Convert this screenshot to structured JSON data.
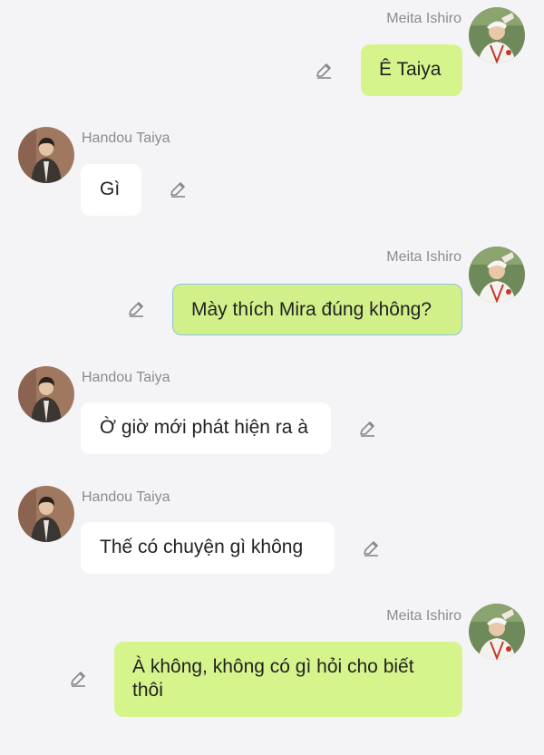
{
  "chat": {
    "messages": [
      {
        "sender": "Meita Ishiro",
        "side": "me",
        "text": "Ê Taiya",
        "avatar_icon": "boy-cap-avatar"
      },
      {
        "sender": "Handou Taiya",
        "side": "them",
        "text": "Gì",
        "avatar_icon": "boy-coat-avatar"
      },
      {
        "sender": "Meita Ishiro",
        "side": "me",
        "text": "Mày thích Mira đúng không?",
        "avatar_icon": "boy-cap-avatar"
      },
      {
        "sender": "Handou Taiya",
        "side": "them",
        "text": "Ờ giờ mới phát hiện ra à",
        "avatar_icon": "boy-coat-avatar"
      },
      {
        "sender": "Handou Taiya",
        "side": "them",
        "text": "Thế có chuyện gì không",
        "avatar_icon": "boy-coat-avatar"
      },
      {
        "sender": "Meita Ishiro",
        "side": "me",
        "text": "À không, không có gì hỏi cho biết thôi",
        "avatar_icon": "boy-cap-avatar"
      }
    ]
  },
  "colors": {
    "background": "#f4f4f6",
    "my_bubble": "#d6f48c",
    "their_bubble": "#ffffff",
    "name_text": "#8c8c8c",
    "selected_border": "#8fc3df"
  },
  "icons": {
    "edit": "pencil-icon"
  }
}
